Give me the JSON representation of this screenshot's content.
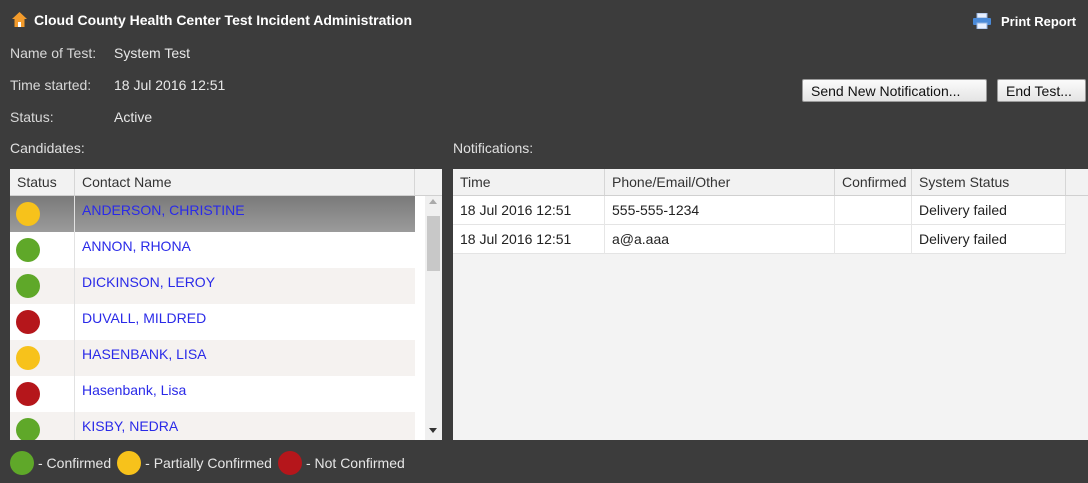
{
  "app": {
    "title": "Cloud County Health Center Test Incident Administration",
    "print_label": "Print Report"
  },
  "info": {
    "name_label": "Name of Test:",
    "name_value": "System Test",
    "time_label": "Time started:",
    "time_value": "18 Jul 2016 12:51",
    "status_label": "Status:",
    "status_value": "Active"
  },
  "actions": {
    "send_label": "Send New Notification...",
    "end_label": "End Test..."
  },
  "candidates": {
    "section_label": "Candidates:",
    "columns": [
      "Status",
      "Contact Name"
    ],
    "rows": [
      {
        "name": "ANDERSON, CHRISTINE",
        "status": "partial",
        "selected": true
      },
      {
        "name": "ANNON, RHONA",
        "status": "confirmed"
      },
      {
        "name": "DICKINSON, LEROY",
        "status": "confirmed"
      },
      {
        "name": "DUVALL, MILDRED",
        "status": "not-confirmed"
      },
      {
        "name": "HASENBANK, LISA",
        "status": "partial"
      },
      {
        "name": "Hasenbank, Lisa",
        "status": "not-confirmed"
      },
      {
        "name": "KISBY, NEDRA",
        "status": "confirmed"
      }
    ]
  },
  "notifications": {
    "section_label": "Notifications:",
    "columns": [
      "Time",
      "Phone/Email/Other",
      "Confirmed",
      "System Status"
    ],
    "rows": [
      {
        "time": "18 Jul 2016 12:51",
        "contact": "555-555-1234",
        "confirmed": "",
        "system_status": "Delivery failed"
      },
      {
        "time": "18 Jul 2016 12:51",
        "contact": "a@a.aaa",
        "confirmed": "",
        "system_status": "Delivery failed"
      }
    ]
  },
  "legend": {
    "confirmed": "- Confirmed",
    "partial": "- Partially Confirmed",
    "not_confirmed": "- Not Confirmed"
  },
  "colors": {
    "confirmed": "#5fa829",
    "partial": "#f7c21b",
    "not-confirmed": "#b5161b",
    "link": "#2a2ae8",
    "background": "#3c3c3c"
  },
  "icons": {
    "home": "home-icon",
    "print": "printer-icon"
  }
}
